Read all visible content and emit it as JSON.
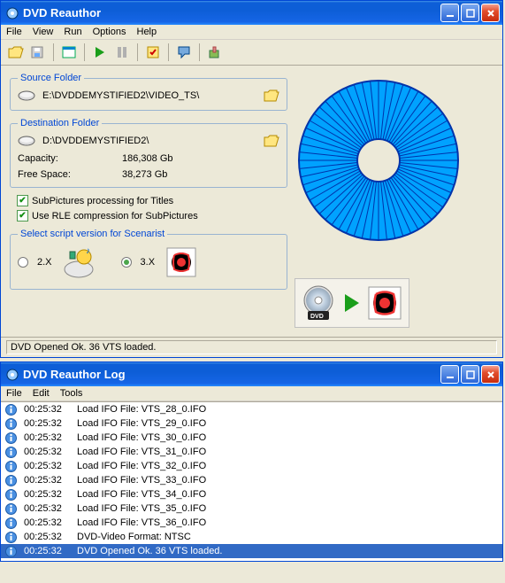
{
  "main": {
    "title": "DVD Reauthor",
    "menu": [
      "File",
      "View",
      "Run",
      "Options",
      "Help"
    ],
    "source": {
      "legend": "Source Folder",
      "path": "E:\\DVDDEMYSTIFIED2\\VIDEO_TS\\"
    },
    "dest": {
      "legend": "Destination Folder",
      "path": "D:\\DVDDEMYSTIFIED2\\",
      "cap_label": "Capacity:",
      "cap_value": "186,308 Gb",
      "free_label": "Free Space:",
      "free_value": "38,273 Gb"
    },
    "checks": {
      "subpic": "SubPictures processing for Titles",
      "rle": "Use RLE compression for SubPictures"
    },
    "scenarist": {
      "legend": "Select script version for Scenarist",
      "opt2x": "2.X",
      "opt3x": "3.X"
    },
    "status": "DVD Opened Ok. 36 VTS loaded."
  },
  "log": {
    "title": "DVD Reauthor Log",
    "menu": [
      "File",
      "Edit",
      "Tools"
    ],
    "rows": [
      {
        "time": "00:25:32",
        "msg": "Load IFO File: VTS_28_0.IFO",
        "sel": false
      },
      {
        "time": "00:25:32",
        "msg": "Load IFO File: VTS_29_0.IFO",
        "sel": false
      },
      {
        "time": "00:25:32",
        "msg": "Load IFO File: VTS_30_0.IFO",
        "sel": false
      },
      {
        "time": "00:25:32",
        "msg": "Load IFO File: VTS_31_0.IFO",
        "sel": false
      },
      {
        "time": "00:25:32",
        "msg": "Load IFO File: VTS_32_0.IFO",
        "sel": false
      },
      {
        "time": "00:25:32",
        "msg": "Load IFO File: VTS_33_0.IFO",
        "sel": false
      },
      {
        "time": "00:25:32",
        "msg": "Load IFO File: VTS_34_0.IFO",
        "sel": false
      },
      {
        "time": "00:25:32",
        "msg": "Load IFO File: VTS_35_0.IFO",
        "sel": false
      },
      {
        "time": "00:25:32",
        "msg": "Load IFO File: VTS_36_0.IFO",
        "sel": false
      },
      {
        "time": "00:25:32",
        "msg": "DVD-Video Format: NTSC",
        "sel": false
      },
      {
        "time": "00:25:32",
        "msg": "DVD Opened Ok. 36 VTS loaded.",
        "sel": true
      }
    ]
  }
}
